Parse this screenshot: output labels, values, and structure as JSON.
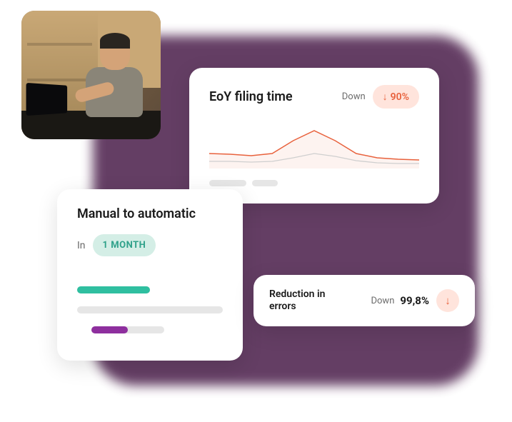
{
  "eoy": {
    "title": "EoY filing time",
    "trend_label": "Down",
    "trend_value": "90%"
  },
  "manual": {
    "title": "Manual to automatic",
    "in_label": "In",
    "duration": "1 MONTH"
  },
  "errors": {
    "title": "Reduction in errors",
    "trend_label": "Down",
    "trend_value": "99,8%"
  },
  "chart_data": [
    {
      "type": "area",
      "title": "EoY filing time",
      "x": [
        0,
        1,
        2,
        3,
        4,
        5,
        6,
        7,
        8,
        9
      ],
      "series": [
        {
          "name": "primary",
          "values": [
            30,
            28,
            25,
            30,
            55,
            75,
            55,
            30,
            22,
            18
          ],
          "color": "#e8613c"
        },
        {
          "name": "secondary",
          "values": [
            15,
            14,
            13,
            15,
            22,
            30,
            24,
            16,
            12,
            10
          ],
          "color": "#cfcfcf"
        }
      ],
      "ylim": [
        0,
        100
      ],
      "trend": {
        "direction": "down",
        "value_pct": 90
      }
    },
    {
      "type": "bar",
      "title": "Manual to automatic",
      "categories": [
        "row1",
        "row2",
        "row3"
      ],
      "series": [
        {
          "name": "track",
          "values": [
            50,
            100,
            60
          ],
          "color": "#e6e6e6"
        },
        {
          "name": "fill",
          "values": [
            50,
            0,
            25
          ],
          "color": [
            "#2fbfa0",
            null,
            "#8e2f9e"
          ]
        }
      ],
      "xlim": [
        0,
        100
      ],
      "duration_months": 1
    }
  ]
}
